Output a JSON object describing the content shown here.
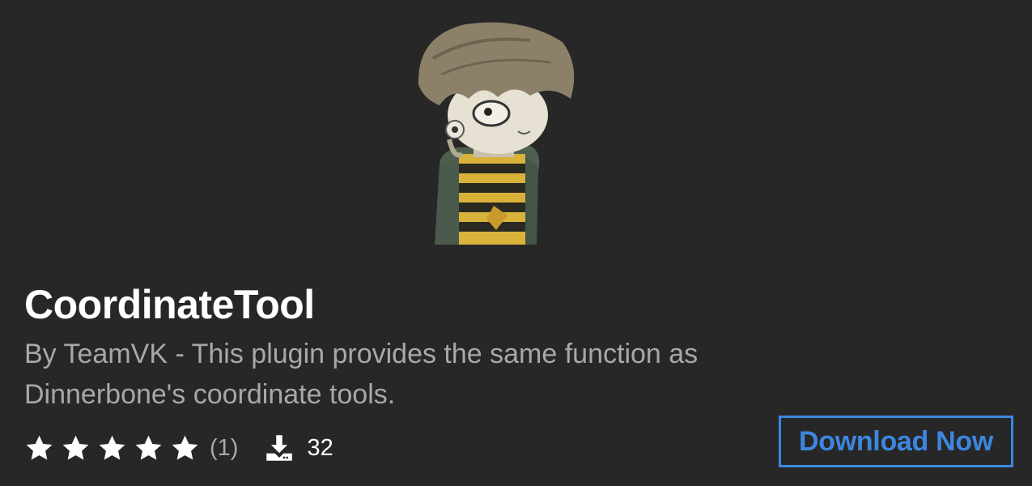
{
  "plugin": {
    "title": "CoordinateTool",
    "description": "By TeamVK - This plugin provides the same function as Dinnerbone's coordinate tools.",
    "image_icon": "cartoon-character-avatar"
  },
  "stats": {
    "rating_stars": 5,
    "rating_max": 5,
    "rating_count": "(1)",
    "downloads": "32",
    "star_icon": "star-icon",
    "download_icon": "download-icon"
  },
  "actions": {
    "download_label": "Download Now"
  },
  "colors": {
    "background": "#272727",
    "title": "#ffffff",
    "description": "#a8a8a8",
    "accent": "#3d86e0"
  }
}
